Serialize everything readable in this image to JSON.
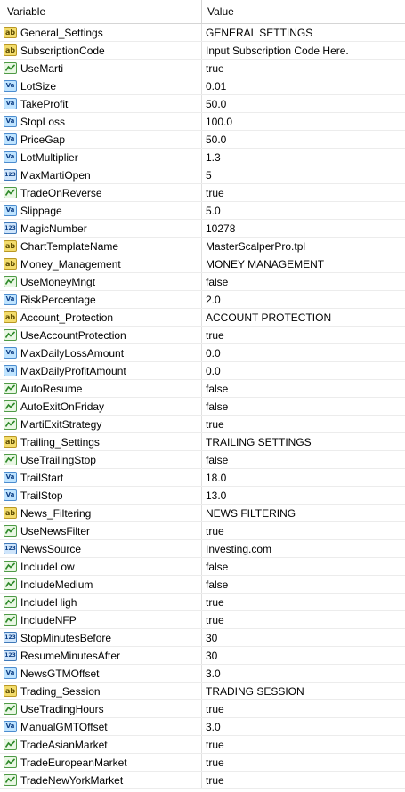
{
  "header": {
    "variable": "Variable",
    "value": "Value"
  },
  "rows": [
    {
      "name": "General_Settings",
      "value": "GENERAL SETTINGS",
      "type": "ab"
    },
    {
      "name": "SubscriptionCode",
      "value": "Input Subscription Code Here.",
      "type": "ab"
    },
    {
      "name": "UseMarti",
      "value": "true",
      "type": "bool"
    },
    {
      "name": "LotSize",
      "value": "0.01",
      "type": "va"
    },
    {
      "name": "TakeProfit",
      "value": "50.0",
      "type": "va"
    },
    {
      "name": "StopLoss",
      "value": "100.0",
      "type": "va"
    },
    {
      "name": "PriceGap",
      "value": "50.0",
      "type": "va"
    },
    {
      "name": "LotMultiplier",
      "value": "1.3",
      "type": "va"
    },
    {
      "name": "MaxMartiOpen",
      "value": "5",
      "type": "123"
    },
    {
      "name": "TradeOnReverse",
      "value": "true",
      "type": "bool"
    },
    {
      "name": "Slippage",
      "value": "5.0",
      "type": "va"
    },
    {
      "name": "MagicNumber",
      "value": "10278",
      "type": "123"
    },
    {
      "name": "ChartTemplateName",
      "value": "MasterScalperPro.tpl",
      "type": "ab"
    },
    {
      "name": "Money_Management",
      "value": "MONEY MANAGEMENT",
      "type": "ab"
    },
    {
      "name": "UseMoneyMngt",
      "value": "false",
      "type": "bool"
    },
    {
      "name": "RiskPercentage",
      "value": "2.0",
      "type": "va"
    },
    {
      "name": "Account_Protection",
      "value": "ACCOUNT PROTECTION",
      "type": "ab"
    },
    {
      "name": "UseAccountProtection",
      "value": "true",
      "type": "bool"
    },
    {
      "name": "MaxDailyLossAmount",
      "value": "0.0",
      "type": "va"
    },
    {
      "name": "MaxDailyProfitAmount",
      "value": "0.0",
      "type": "va"
    },
    {
      "name": "AutoResume",
      "value": "false",
      "type": "bool"
    },
    {
      "name": "AutoExitOnFriday",
      "value": "false",
      "type": "bool"
    },
    {
      "name": "MartiExitStrategy",
      "value": "true",
      "type": "bool"
    },
    {
      "name": "Trailing_Settings",
      "value": "TRAILING SETTINGS",
      "type": "ab"
    },
    {
      "name": "UseTrailingStop",
      "value": "false",
      "type": "bool"
    },
    {
      "name": "TrailStart",
      "value": "18.0",
      "type": "va"
    },
    {
      "name": "TrailStop",
      "value": "13.0",
      "type": "va"
    },
    {
      "name": "News_Filtering",
      "value": "NEWS FILTERING",
      "type": "ab"
    },
    {
      "name": "UseNewsFilter",
      "value": "true",
      "type": "bool"
    },
    {
      "name": "NewsSource",
      "value": "Investing.com",
      "type": "123"
    },
    {
      "name": "IncludeLow",
      "value": "false",
      "type": "bool"
    },
    {
      "name": "IncludeMedium",
      "value": "false",
      "type": "bool"
    },
    {
      "name": "IncludeHigh",
      "value": "true",
      "type": "bool"
    },
    {
      "name": "IncludeNFP",
      "value": "true",
      "type": "bool"
    },
    {
      "name": "StopMinutesBefore",
      "value": "30",
      "type": "123"
    },
    {
      "name": "ResumeMinutesAfter",
      "value": "30",
      "type": "123"
    },
    {
      "name": "NewsGTMOffset",
      "value": "3.0",
      "type": "va"
    },
    {
      "name": "Trading_Session",
      "value": "TRADING SESSION",
      "type": "ab"
    },
    {
      "name": "UseTradingHours",
      "value": "true",
      "type": "bool"
    },
    {
      "name": "ManualGMTOffset",
      "value": "3.0",
      "type": "va"
    },
    {
      "name": "TradeAsianMarket",
      "value": "true",
      "type": "bool"
    },
    {
      "name": "TradeEuropeanMarket",
      "value": "true",
      "type": "bool"
    },
    {
      "name": "TradeNewYorkMarket",
      "value": "true",
      "type": "bool"
    }
  ],
  "icons": {
    "ab": {
      "name": "string-type-icon",
      "text": "ab"
    },
    "va": {
      "name": "double-type-icon",
      "text": "Va"
    },
    "123": {
      "name": "integer-type-icon",
      "text": "123"
    },
    "bool": {
      "name": "bool-type-icon",
      "text": ""
    }
  }
}
